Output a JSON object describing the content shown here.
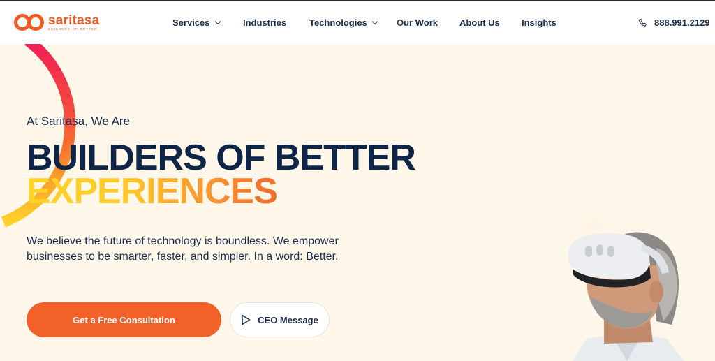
{
  "brand": {
    "name": "saritasa",
    "tagline": "BUILDERS OF BETTER",
    "accent": "#f05a24"
  },
  "nav": {
    "items": [
      {
        "label": "Services",
        "dropdown": true
      },
      {
        "label": "Industries",
        "dropdown": false
      },
      {
        "label": "Technologies",
        "dropdown": true
      },
      {
        "label": "Our Work",
        "dropdown": false
      },
      {
        "label": "About Us",
        "dropdown": false
      },
      {
        "label": "Insights",
        "dropdown": false
      }
    ],
    "phone": "888.991.2129",
    "phone_icon": "phone-icon"
  },
  "hero": {
    "intro": "At Saritasa, We Are",
    "headline_line1": "BUILDERS OF BETTER",
    "headline_line2": "EXPERIENCES",
    "description": "We believe the future of technology is boundless. We empower businesses to be smarter, faster, and simpler. In a word: Better.",
    "primary_button": "Get a Free Consultation",
    "secondary_button": "CEO Message",
    "secondary_icon": "play-icon"
  },
  "colors": {
    "navy": "#0f2548",
    "orange": "#f2612a",
    "yellow": "#ffd42a",
    "background": "#fff8ea"
  }
}
